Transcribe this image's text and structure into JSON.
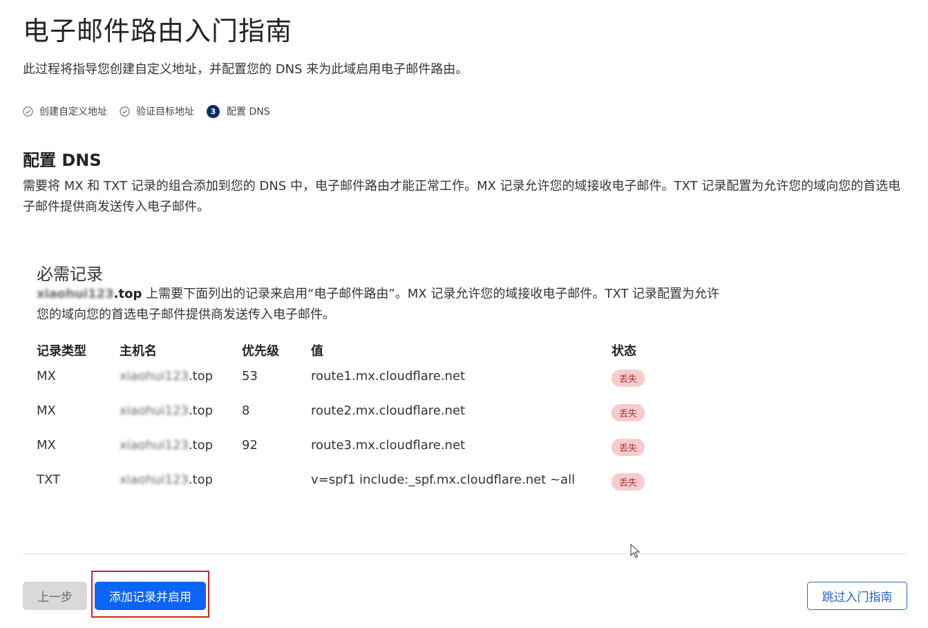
{
  "page": {
    "title": "电子邮件路由入门指南",
    "subtitle": "此过程将指导您创建自定义地址，并配置您的 DNS 来为此域启用电子邮件路由。"
  },
  "steps": [
    {
      "label": "创建自定义地址",
      "state": "done"
    },
    {
      "label": "验证目标地址",
      "state": "done"
    },
    {
      "number": "3",
      "label": "配置 DNS",
      "state": "current"
    }
  ],
  "section": {
    "title": "配置 DNS",
    "description": "需要将 MX 和 TXT 记录的组合添加到您的 DNS 中，电子邮件路由才能正常工作。MX 记录允许您的域接收电子邮件。TXT 记录配置为允许您的域向您的首选电子邮件提供商发送传入电子邮件。"
  },
  "required": {
    "title": "必需记录",
    "domain_prefix": "xiaohui123",
    "domain_suffix": ".top",
    "description": " 上需要下面列出的记录来启用“电子邮件路由”。MX 记录允许您的域接收电子邮件。TXT 记录配置为允许您的域向您的首选电子邮件提供商发送传入电子邮件。"
  },
  "table": {
    "headers": {
      "type": "记录类型",
      "host": "主机名",
      "priority": "优先级",
      "value": "值",
      "status": "状态"
    },
    "rows": [
      {
        "type": "MX",
        "host_prefix": "xiaohui123",
        "host_suffix": ".top",
        "priority": "53",
        "value": "route1.mx.cloudflare.net",
        "status": "丢失"
      },
      {
        "type": "MX",
        "host_prefix": "xiaohui123",
        "host_suffix": ".top",
        "priority": "8",
        "value": "route2.mx.cloudflare.net",
        "status": "丢失"
      },
      {
        "type": "MX",
        "host_prefix": "xiaohui123",
        "host_suffix": ".top",
        "priority": "92",
        "value": "route3.mx.cloudflare.net",
        "status": "丢失"
      },
      {
        "type": "TXT",
        "host_prefix": "xiaohui123",
        "host_suffix": ".top",
        "priority": "",
        "value": "v=spf1 include:_spf.mx.cloudflare.net ~all",
        "status": "丢失"
      }
    ]
  },
  "buttons": {
    "prev": "上一步",
    "add_enable": "添加记录并启用",
    "skip": "跳过入门指南"
  },
  "colors": {
    "primary": "#0a64f7",
    "badge_bg": "#f8cccc",
    "highlight": "#d42020",
    "step_active": "#0c2a6b"
  }
}
